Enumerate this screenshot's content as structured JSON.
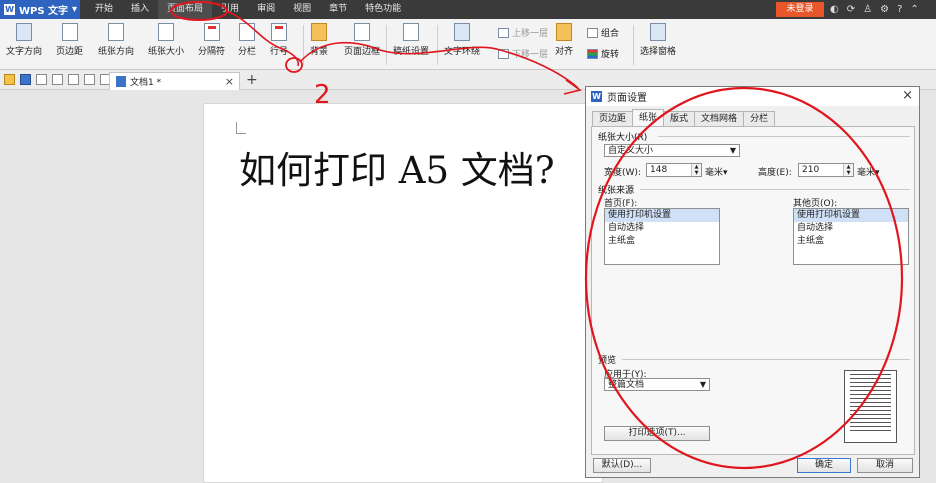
{
  "app": {
    "name": "WPS 文字",
    "logo": "W"
  },
  "menu": {
    "items": [
      "开始",
      "插入",
      "页面布局",
      "引用",
      "审阅",
      "视图",
      "章节",
      "特色功能"
    ],
    "active": "页面布局",
    "login": "未登录"
  },
  "ribbon": {
    "text_direction": "文字方向",
    "margins": "页边距",
    "orientation": "纸张方向",
    "size": "纸张大小",
    "breaks": "分隔符",
    "columns": "分栏",
    "line_numbers": "行号",
    "background": "背景",
    "page_border": "页面边框",
    "draft_setup": "稿纸设置",
    "wrap_text": "文字环绕",
    "bring_forward": "上移一层",
    "send_backward": "下移一层",
    "align": "对齐",
    "group": "组合",
    "rotate": "旋转",
    "selection_pane": "选择窗格"
  },
  "tabbar": {
    "doc_tab": "文档1 *",
    "close": "×",
    "add": "+"
  },
  "document": {
    "text": "如何打印 A5 文档?"
  },
  "dialog": {
    "title": "页面设置",
    "close": "×",
    "tabs": [
      "页边距",
      "纸张",
      "版式",
      "文档网格",
      "分栏"
    ],
    "active_tab": "纸张",
    "paper_size_group": "纸张大小(R)",
    "paper_size_value": "自定义大小",
    "width_label": "宽度(W):",
    "width_value": "148",
    "width_unit": "毫米▾",
    "height_label": "高度(E):",
    "height_value": "210",
    "height_unit": "毫米▾",
    "source_group": "纸张来源",
    "first_page_label": "首页(F):",
    "other_pages_label": "其他页(O):",
    "first_page_options": [
      "使用打印机设置",
      "自动选择",
      "主纸盒"
    ],
    "other_pages_options": [
      "使用打印机设置",
      "自动选择",
      "主纸盒"
    ],
    "preview_group": "预览",
    "apply_to_label": "应用于(Y):",
    "apply_to_value": "整篇文档",
    "print_options": "打印选项(T)...",
    "default_button": "默认(D)...",
    "ok_button": "确定",
    "cancel_button": "取消"
  },
  "annotation": {
    "step_number": "2",
    "color": "#e0161e"
  }
}
